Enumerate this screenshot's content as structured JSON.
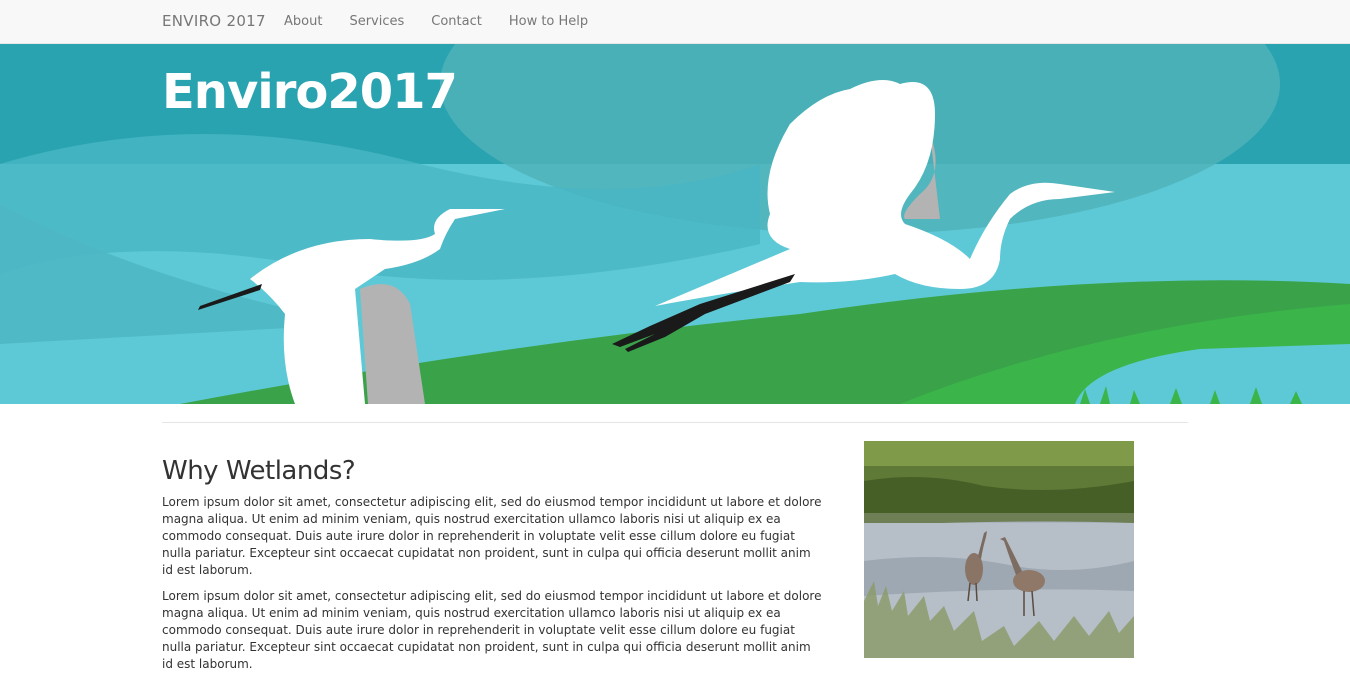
{
  "navbar": {
    "brand": "ENVIRO 2017",
    "links": [
      {
        "label": "About"
      },
      {
        "label": "Services"
      },
      {
        "label": "Contact"
      },
      {
        "label": "How to Help"
      }
    ]
  },
  "hero": {
    "title": "Enviro2017"
  },
  "main": {
    "heading": "Why Wetlands?",
    "paragraphs": [
      "Lorem ipsum dolor sit amet, consectetur adipiscing elit, sed do eiusmod tempor incididunt ut labore et dolore magna aliqua. Ut enim ad minim veniam, quis nostrud exercitation ullamco laboris nisi ut aliquip ex ea commodo consequat. Duis aute irure dolor in reprehenderit in voluptate velit esse cillum dolore eu fugiat nulla pariatur. Excepteur sint occaecat cupidatat non proident, sunt in culpa qui officia deserunt mollit anim id est laborum.",
      "Lorem ipsum dolor sit amet, consectetur adipiscing elit, sed do eiusmod tempor incididunt ut labore et dolore magna aliqua. Ut enim ad minim veniam, quis nostrud exercitation ullamco laboris nisi ut aliquip ex ea commodo consequat. Duis aute irure dolor in reprehenderit in voluptate velit esse cillum dolore eu fugiat nulla pariatur. Excepteur sint occaecat cupidatat non proident, sunt in culpa qui officia deserunt mollit anim id est laborum."
    ]
  },
  "colors": {
    "sky_dark": "#2aa3b1",
    "sky_light": "#5ec9d6",
    "hill_green": "#3aa34a",
    "hill_bright": "#3bb54a",
    "bird_white": "#ffffff",
    "bird_shadow": "#b3b3b3"
  }
}
